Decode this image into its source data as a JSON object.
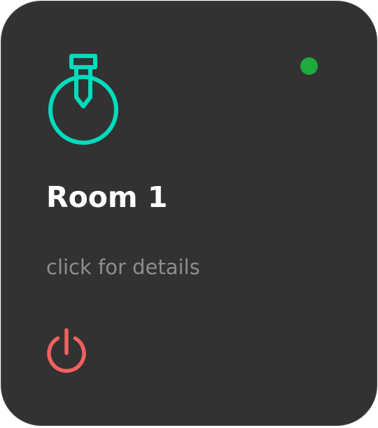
{
  "card": {
    "title": "Room 1",
    "subtitle": "click for details",
    "device_icon": "pendant-lamp-icon",
    "status": {
      "icon": "status-dot-icon",
      "state": "online",
      "color": "#1faa3c"
    },
    "power": {
      "icon": "power-icon",
      "color": "#f0625f"
    },
    "colors": {
      "background": "#323232",
      "accent": "#00dcbe",
      "title": "#ffffff",
      "subtitle": "#8d8d8d"
    }
  }
}
